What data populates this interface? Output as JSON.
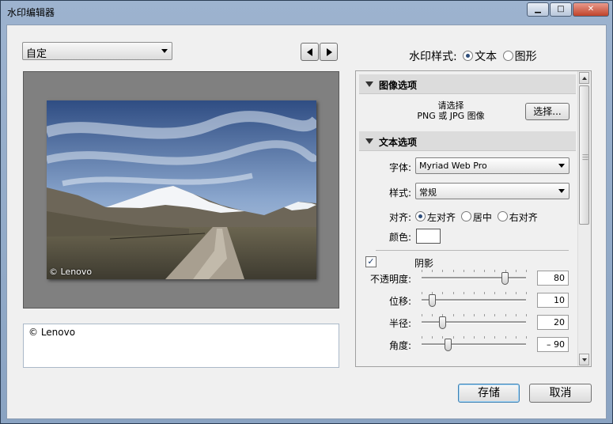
{
  "window": {
    "title": "水印编辑器",
    "controls": [
      "minimize",
      "maximize",
      "close"
    ]
  },
  "preset": {
    "value": "自定"
  },
  "nav": {
    "prev_icon": "triangle-left-icon",
    "next_icon": "triangle-right-icon"
  },
  "watermark_style": {
    "label": "水印样式:",
    "options": [
      "文本",
      "图形"
    ],
    "selected": "文本"
  },
  "preview": {
    "watermark_text": "© Lenovo"
  },
  "text_input": {
    "value": "© Lenovo"
  },
  "image_options": {
    "header": "图像选项",
    "prompt_line1": "请选择",
    "prompt_line2": "PNG 或 JPG 图像",
    "choose_button": "选择..."
  },
  "text_options": {
    "header": "文本选项",
    "font_label": "字体:",
    "font_value": "Myriad Web Pro",
    "style_label": "样式:",
    "style_value": "常规",
    "align_label": "对齐:",
    "align_options": [
      "左对齐",
      "居中",
      "右对齐"
    ],
    "align_selected": "左对齐",
    "color_label": "颜色:",
    "color_value": "#ffffff",
    "shadow_label": "阴影",
    "shadow_checked": true,
    "sliders": [
      {
        "label": "不透明度:",
        "value": "80",
        "fraction": 0.8
      },
      {
        "label": "位移:",
        "value": "10",
        "fraction": 0.1
      },
      {
        "label": "半径:",
        "value": "20",
        "fraction": 0.2
      },
      {
        "label": "角度:",
        "value": "– 90",
        "fraction": 0.25
      }
    ]
  },
  "buttons": {
    "save": "存储",
    "cancel": "取消"
  }
}
